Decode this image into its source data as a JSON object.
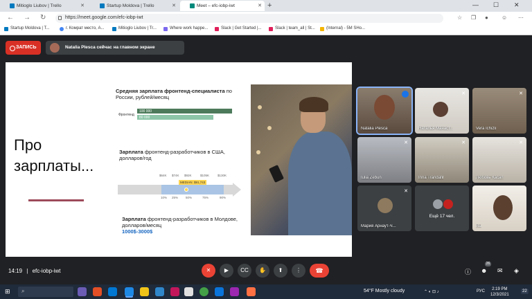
{
  "browser": {
    "tabs": [
      {
        "label": "Mitioglo Liubov | Trello",
        "active": false
      },
      {
        "label": "Startup Moldova | Trello",
        "active": false
      },
      {
        "label": "Meet – efc-iobp-iwt",
        "active": true
      }
    ],
    "url": "https://meet.google.com/efc-iobp-iwt",
    "bookmarks": [
      "Startup Moldova | T...",
      "г. Комрат место, А...",
      "Mitioglo Liubov | Tr...",
      "Where work happe...",
      "Slack | Get Started |...",
      "Slack | team_all | St...",
      "(Internal) - 5M SHo..."
    ]
  },
  "meet": {
    "record_label": "ЗАПИСЬ",
    "presenter_text": "Natalia Plesca сейчас на главном экране",
    "meeting_time": "14:19",
    "meeting_code": "efc-iobp-iwt",
    "participants_count": "26",
    "participants": [
      {
        "name": "Natalia Plesca",
        "speaking": true
      },
      {
        "name": "Наталья Манаст...",
        "speaking": false
      },
      {
        "name": "Vera Ichizli",
        "speaking": false
      },
      {
        "name": "Iulia Zebun",
        "speaking": false
      },
      {
        "name": "Inna Trandafil",
        "speaking": false
      },
      {
        "name": "Любовь Касап",
        "speaking": false
      },
      {
        "name": "Мария Арнаут-Ч...",
        "speaking": false
      },
      {
        "name": "Ещё 17 чел.",
        "speaking": false
      },
      {
        "name": "Вы",
        "speaking": false
      }
    ]
  },
  "slide": {
    "title": "Про\nзарплаты...",
    "block1_bold": "Средняя зарплата фронтенд-специалиста",
    "block1_rest": "по России, рублей/месяц",
    "bar_label": "Фронтенд",
    "bar_values": [
      "100 000",
      "80 000"
    ],
    "block2_bold": "Зарплата",
    "block2_rest": "фронтенд-разработчиков в США, долларов/год",
    "us_ticks_top": [
      "$64K",
      "$74K",
      "$92K",
      "$105K",
      "$130K"
    ],
    "us_median": "MEDIAN: $91,743",
    "us_ticks_bottom": [
      "10%",
      "25%",
      "50%",
      "75%",
      "90%"
    ],
    "block3_bold": "Зарплата",
    "block3_rest": "фронтенд-разработчиков в Молдове, долларов/месяц",
    "moldova_range": "1000$-3000$"
  },
  "taskbar": {
    "weather": "54°F Mostly cloudy",
    "lang": "РУС",
    "time": "2:19 PM",
    "date": "12/3/2021",
    "notif": "22"
  },
  "colors": {
    "meet_bg": "#202124",
    "record_red": "#d93025",
    "end_call": "#ea4335",
    "accent_blue": "#1565c0",
    "bar_dark": "#4c7a5a",
    "bar_light": "#8cc5a8"
  },
  "icons": [
    "back-icon",
    "forward-icon",
    "refresh-icon",
    "lock-icon",
    "mic-off-icon",
    "camera-icon",
    "captions-icon",
    "hand-icon",
    "present-icon",
    "more-icon",
    "end-call-icon",
    "info-icon",
    "people-icon",
    "chat-icon",
    "activities-icon"
  ]
}
